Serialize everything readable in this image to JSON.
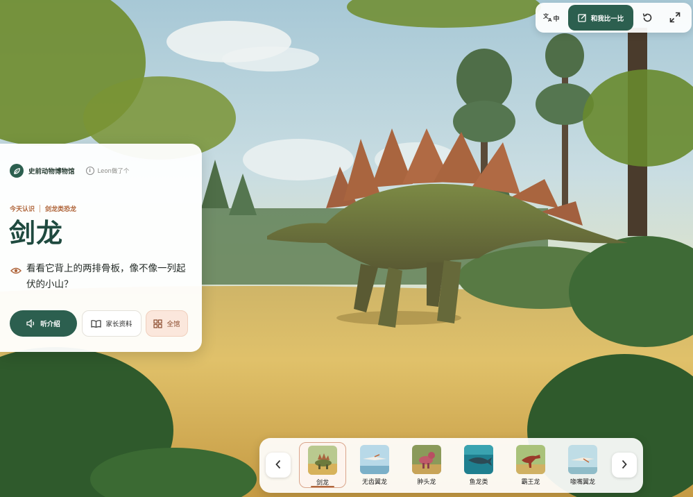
{
  "museum": {
    "name": "史前动物博物馆",
    "credit": "Leon做了个"
  },
  "tags": {
    "today": "今天认识",
    "category": "剑龙类恐龙"
  },
  "dinosaur": {
    "name": "剑龙",
    "question": "看看它背上的两排骨板，像不像一列起伏的小山？"
  },
  "buttons": {
    "listen": "听介绍",
    "parent": "家长资料",
    "all": "全馆"
  },
  "toolbar": {
    "lang": "中",
    "compare": "和我比一比"
  },
  "carousel": {
    "items": [
      {
        "label": "剑龙",
        "icon": "stegosaurus-thumb",
        "active": true
      },
      {
        "label": "无齿翼龙",
        "icon": "pteranodon-thumb"
      },
      {
        "label": "肿头龙",
        "icon": "pachycephalosaurus-thumb"
      },
      {
        "label": "鱼龙类",
        "icon": "ichthyosaur-thumb"
      },
      {
        "label": "霸王龙",
        "icon": "trex-thumb"
      },
      {
        "label": "喙嘴翼龙",
        "icon": "rhamphorhynchus-thumb"
      }
    ]
  },
  "colors": {
    "primary": "#2c5f4f",
    "accent": "#b0663c",
    "title": "#1f4a3f"
  }
}
